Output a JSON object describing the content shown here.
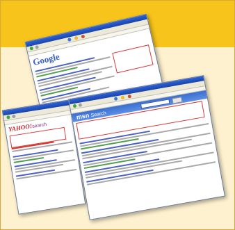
{
  "colors": {
    "top_band": "#f6c41a",
    "bottom_band": "#fdf1cf",
    "window_title": "#2d63d8",
    "highlight_box": "#d83a3a",
    "link_blue": "#4a62c8",
    "url_green": "#53a04c"
  },
  "windows": {
    "google": {
      "logo": "Google"
    },
    "yahoo": {
      "logo": "YAHOO!",
      "logo_suffix": "search"
    },
    "msn": {
      "logo": "msn",
      "search_label": "Search"
    }
  },
  "icons": [
    "back-icon",
    "forward-icon",
    "search-icon",
    "favorites-icon",
    "home-icon"
  ]
}
